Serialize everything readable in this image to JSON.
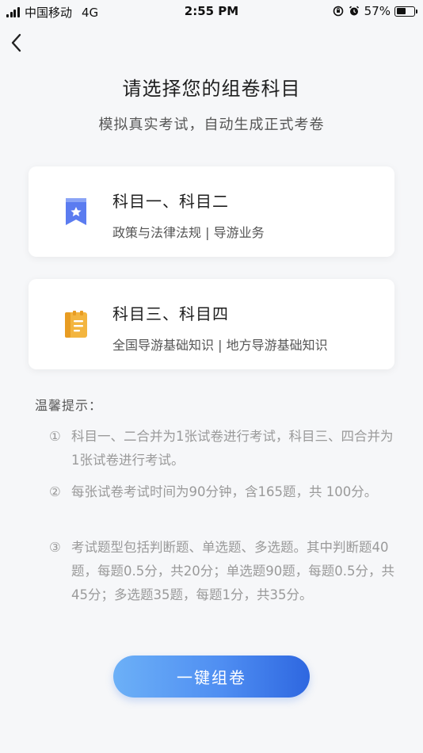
{
  "status_bar": {
    "carrier": "中国移动",
    "network": "4G",
    "time": "2:55 PM",
    "battery_percent": "57%",
    "battery_level": 0.57
  },
  "header": {
    "back_icon": "chevron-left-icon",
    "title": "请选择您的组卷科目",
    "subtitle": "模拟真实考试，自动生成正式考卷"
  },
  "cards": [
    {
      "title": "科目一、科目二",
      "desc": "政策与法律法规 | 导游业务",
      "icon": "bookmark-star-icon",
      "color": "#5b7cf0"
    },
    {
      "title": "科目三、科目四",
      "desc": "全国导游基础知识 | 地方导游基础知识",
      "icon": "notebook-icon",
      "color": "#f3b53f"
    }
  ],
  "tips": {
    "title": "温馨提示：",
    "items": [
      {
        "num": "①",
        "text": "科目一、二合并为1张试卷进行考试，科目三、四合并为1张试卷进行考试。"
      },
      {
        "num": "②",
        "text": "每张试卷考试时间为90分钟，含165题，共 100分。"
      },
      {
        "num": "③",
        "text": "考试题型包括判断题、单选题、多选题。其中判断题40题，每题0.5分，共20分；单选题90题，每题0.5分，共45分；多选题35题，每题1分，共35分。"
      }
    ]
  },
  "action": {
    "label": "一键组卷",
    "color": "#4f8ef2"
  }
}
